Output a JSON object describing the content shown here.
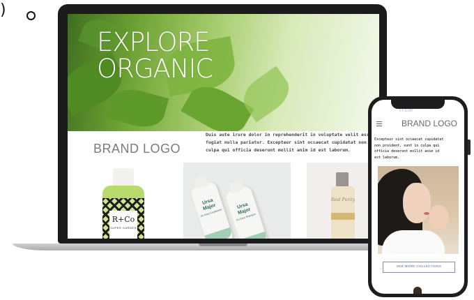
{
  "corner_glyph": ")",
  "laptop": {
    "hero_title_line1": "EXPLORE",
    "hero_title_line2": "ORGANIC",
    "brand_logo": "BRAND LOGO",
    "body_text_lines": [
      "Duis aute irure dolor in reprehenderit in voluptate velit esse cillum",
      "fugiat nulla pariatur. Excepteur sint occaecat cupidatat non proid",
      "culpa qui officia deserunt mollit anim id est laborum."
    ],
    "products": [
      {
        "name": "R+Co Super Garden",
        "brand_mark": "R+Co",
        "label_sub": "SUPER GARDEN"
      },
      {
        "name": "Ursa Major",
        "brand_line1": "Ursa",
        "brand_line2": "Major",
        "variants": [
          "Go Easy Conditioner",
          "Go Easy Shampoo"
        ]
      },
      {
        "name": "Real Purity",
        "script": "Real Purity"
      }
    ]
  },
  "phone": {
    "header_ghost": "ITEM",
    "brand_logo": "BRAND LOGO",
    "body_text_lines": [
      "Excepteur sint occaecat cupidatat",
      "non proident, sunt in culpa qui",
      "officia deserunt mollit anim id",
      "est laborum."
    ],
    "cta_label": "SEE MORE COLLECTIONS"
  },
  "colors": {
    "hero_green": "#6fa334",
    "device_frame": "#1b1b1d",
    "cta_border": "#7a8fb5"
  }
}
